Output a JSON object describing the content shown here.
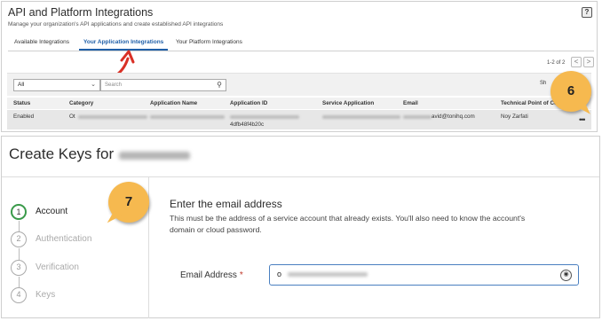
{
  "top": {
    "title": "API and Platform Integrations",
    "subtitle": "Manage your organization's API applications and create established API integrations",
    "help_icon": "?",
    "tabs": [
      {
        "label": "Available Integrations"
      },
      {
        "label": "Your Application Integrations",
        "active": true
      },
      {
        "label": "Your Platform Integrations"
      }
    ],
    "pager": {
      "text": "1-2 of 2",
      "prev": "<",
      "next": ">"
    },
    "filter": {
      "selected": "All",
      "search_placeholder": "Search"
    },
    "show_label": "Sh",
    "table": {
      "headers": [
        "Status",
        "Category",
        "Application Name",
        "Application ID",
        "Service Application",
        "Email",
        "Technical Point of Contact"
      ],
      "row": {
        "status": "Enabled",
        "category": "Ot",
        "app_id_sub": "4dfb48f4b20c",
        "email": "avid@tonihq.com",
        "contact": "Noy Zarfati",
        "more": "•••"
      }
    },
    "badge": "6"
  },
  "bottom": {
    "title": "Create Keys for",
    "steps": [
      {
        "num": "1",
        "label": "Account",
        "active": true
      },
      {
        "num": "2",
        "label": "Authentication"
      },
      {
        "num": "3",
        "label": "Verification"
      },
      {
        "num": "4",
        "label": "Keys"
      }
    ],
    "badge": "7",
    "heading": "Enter the email address",
    "description": "This must be the address of a service account that already exists. You'll also need to know the account's domain or cloud password.",
    "email_label": "Email Address",
    "required_mark": "*",
    "email_value": "o"
  },
  "colors": {
    "accent": "#1f5fa8",
    "badge": "#f6b94f",
    "step_active": "#3a9a4a",
    "arrow": "#d93025"
  }
}
